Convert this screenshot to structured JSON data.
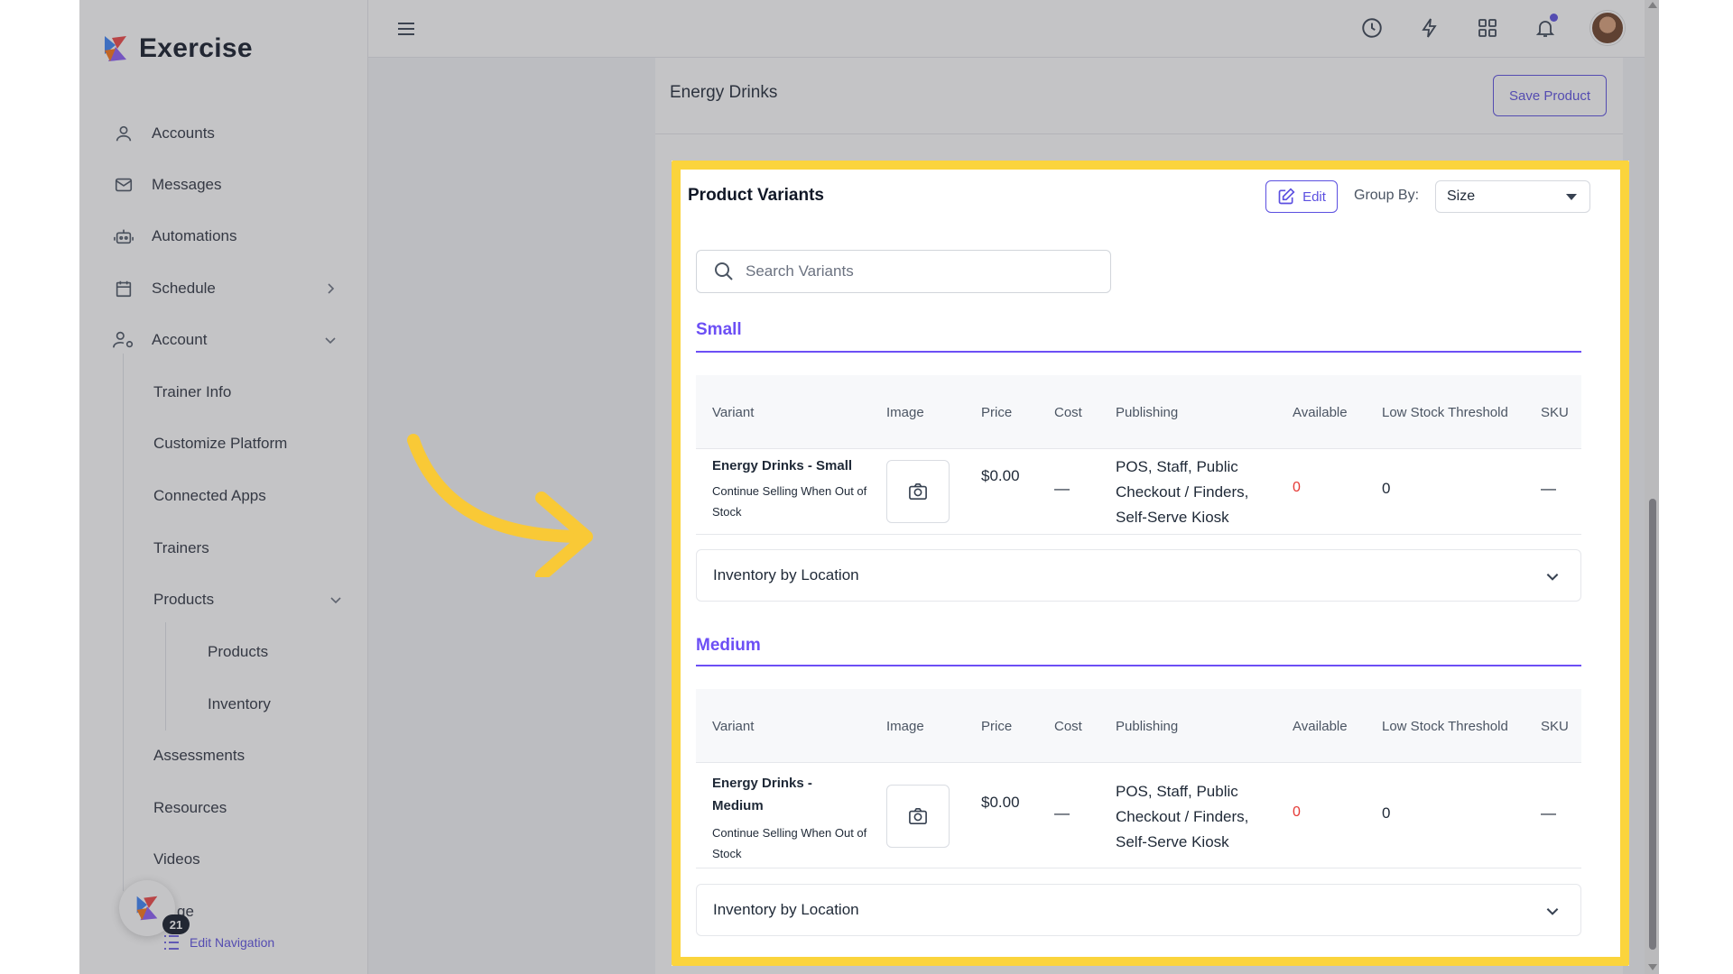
{
  "brand": {
    "name": "Exercise"
  },
  "sidebar": {
    "items": [
      {
        "label": "Accounts",
        "icon": "user-icon"
      },
      {
        "label": "Messages",
        "icon": "mail-icon"
      },
      {
        "label": "Automations",
        "icon": "robot-icon"
      },
      {
        "label": "Schedule",
        "icon": "calendar-icon"
      },
      {
        "label": "Account",
        "icon": "user-gear-icon"
      }
    ],
    "account_sub": [
      "Trainer Info",
      "Customize Platform",
      "Connected Apps",
      "Trainers",
      "Products",
      "Assessments",
      "Resources",
      "Videos"
    ],
    "products_sub": [
      "Products",
      "Inventory"
    ],
    "partial_item": "ge",
    "badge_count": "21",
    "edit_navigation": "Edit Navigation"
  },
  "header": {
    "product_title": "Energy Drinks",
    "save_button": "Save Product"
  },
  "variants": {
    "title": "Product Variants",
    "edit_button": "Edit",
    "group_by_label": "Group By:",
    "group_by_value": "Size",
    "search_placeholder": "Search Variants",
    "columns": [
      "Variant",
      "Image",
      "Price",
      "Cost",
      "Publishing",
      "Available",
      "Low Stock Threshold",
      "SKU"
    ],
    "inventory_label": "Inventory by Location",
    "groups": [
      {
        "name": "Small",
        "row": {
          "variant": "Energy Drinks - Small",
          "note": "Continue Selling When Out of Stock",
          "price": "$0.00",
          "cost": "—",
          "publishing": "POS, Staff, Public Checkout / Finders, Self-Serve Kiosk",
          "available": "0",
          "low_stock": "0",
          "sku": "—"
        }
      },
      {
        "name": "Medium",
        "row": {
          "variant": "Energy Drinks - Medium",
          "note": "Continue Selling When Out of Stock",
          "price": "$0.00",
          "cost": "—",
          "publishing": "POS, Staff, Public Checkout / Finders, Self-Serve Kiosk",
          "available": "0",
          "low_stock": "0",
          "sku": "—"
        }
      }
    ]
  },
  "colors": {
    "accent": "#6c4ff5",
    "highlight": "#fbd43c",
    "alert": "#e53935",
    "arrow": "#f9c936"
  }
}
